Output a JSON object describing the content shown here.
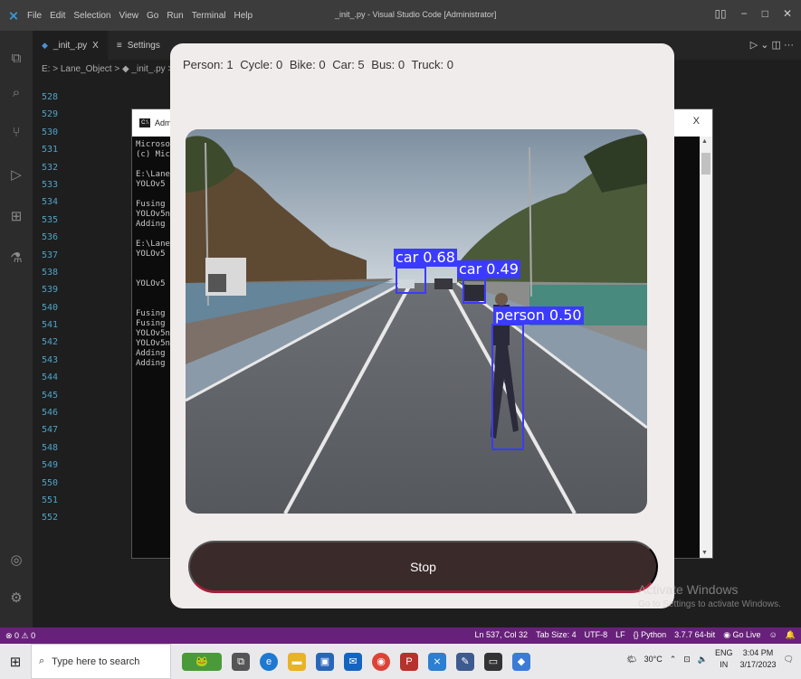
{
  "vscode": {
    "title": "_init_.py - Visual Studio Code [Administrator]",
    "menu": [
      "File",
      "Edit",
      "Selection",
      "View",
      "Go",
      "Run",
      "Terminal",
      "Help"
    ],
    "tabs": [
      {
        "label": "_init_.py",
        "close": "X",
        "active": true
      },
      {
        "label": "Settings",
        "active": false
      }
    ],
    "breadcrumb": "E: > Lane_Object > ◆ _init_.py > ",
    "line_numbers": [
      "528",
      "529",
      "530",
      "531",
      "532",
      "533",
      "534",
      "535",
      "536",
      "537",
      "538",
      "539",
      "540",
      "541",
      "542",
      "543",
      "544",
      "545",
      "546",
      "547",
      "548",
      "549",
      "550",
      "551",
      "552"
    ]
  },
  "cmd": {
    "title": "Admin",
    "close": "X",
    "lines": [
      "Microsof",
      "(c) Micr",
      "",
      "E:\\Lane_",
      "YOLOv5",
      "",
      "Fusing l",
      "YOLOv5n",
      "Adding A",
      "",
      "E:\\Lane_",
      "YOLOv5",
      "",
      "",
      "YOLOv5",
      "",
      "",
      "Fusing l",
      "Fusing l",
      "YOLOv5n",
      "YOLOv5n",
      "Adding A",
      "Adding A"
    ]
  },
  "app": {
    "counts": {
      "person": "Person: 1",
      "cycle": "Cycle: 0",
      "bike": "Bike: 0",
      "car": "Car: 5",
      "bus": "Bus: 0",
      "truck": "Truck: 0"
    },
    "detections": [
      {
        "label": "car 0.68"
      },
      {
        "label": "car 0.49"
      },
      {
        "label": "person 0.50"
      }
    ],
    "stop_label": "Stop"
  },
  "watermark": {
    "line1": "Activate Windows",
    "line2": "Go to Settings to activate Windows."
  },
  "statusbar": {
    "left": "⊗ 0 ⚠ 0",
    "position": "Ln 537, Col 32",
    "tab_size": "Tab Size: 4",
    "encoding": "UTF-8",
    "eol": "LF",
    "language": "{} Python",
    "interpreter": "3.7.7 64-bit",
    "golive": "Go Live"
  },
  "taskbar": {
    "search_placeholder": "Type here to search",
    "weather": "30°C",
    "language": "ENG",
    "region": "IN",
    "time": "3:04 PM",
    "date": "3/17/2023"
  },
  "colors": {
    "statusbar": "#68217a",
    "bbox": "#3b3bff",
    "stop_button": "#3b2a2a",
    "app_background": "#f1ecec"
  }
}
